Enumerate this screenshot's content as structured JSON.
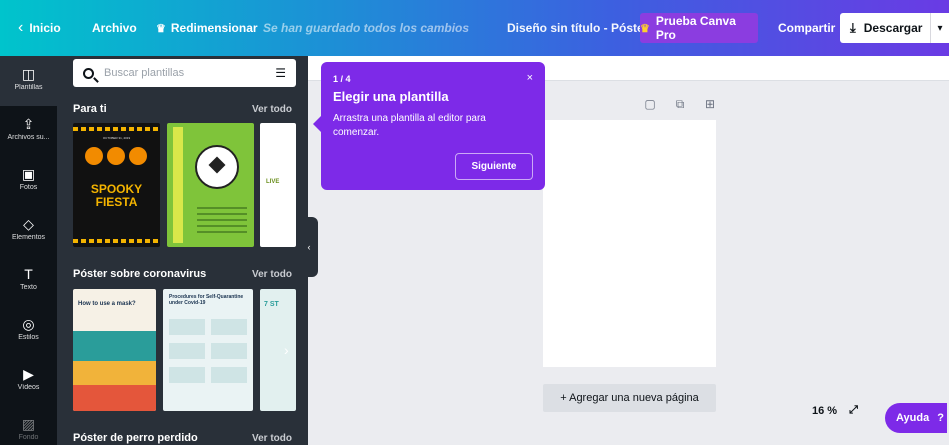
{
  "topbar": {
    "home_label": "Inicio",
    "file_label": "Archivo",
    "resize_label": "Redimensionar",
    "save_status": "Se han guardado todos los cambios",
    "document_title": "Diseño sin título - Póster",
    "pro_label": "Prueba Canva Pro",
    "share_label": "Compartir",
    "download_label": "Descargar"
  },
  "sidebar": {
    "items": [
      {
        "label": "Plantillas",
        "icon": "template-icon"
      },
      {
        "label": "Archivos su...",
        "icon": "upload-icon"
      },
      {
        "label": "Fotos",
        "icon": "photo-icon"
      },
      {
        "label": "Elementos",
        "icon": "shapes-icon"
      },
      {
        "label": "Texto",
        "icon": "text-icon"
      },
      {
        "label": "Estilos",
        "icon": "palette-icon"
      },
      {
        "label": "Vídeos",
        "icon": "video-icon"
      },
      {
        "label": "Fondo",
        "icon": "background-icon"
      }
    ]
  },
  "panel": {
    "search_placeholder": "Buscar plantillas",
    "sections": [
      {
        "title": "Para ti",
        "link": "Ver todo"
      },
      {
        "title": "Póster sobre coronavirus",
        "link": "Ver todo"
      },
      {
        "title": "Póster de perro perdido",
        "link": "Ver todo"
      }
    ],
    "thumbs": {
      "spooky_date": "OCTOBER 31, 2019",
      "spooky_title1": "SPOOKY",
      "spooky_title2": "FIESTA",
      "soccer_text": "SOCCER MATCH",
      "live_text": "LIVE",
      "mask_title": "How to use a mask?",
      "covid_title": "Procedures for Self-Quarantine under Covid-19",
      "steps_text": "7 ST"
    }
  },
  "tooltip": {
    "step": "1 / 4",
    "title": "Elegir una plantilla",
    "body": "Arrastra una plantilla al editor para comenzar.",
    "next_label": "Siguiente",
    "close": "×"
  },
  "canvas": {
    "add_page_label": "+ Agregar una nueva página"
  },
  "footer": {
    "zoom": "16 %",
    "help_label": "Ayuda",
    "help_q": "?"
  },
  "colors": {
    "accent": "#7d2ae8",
    "sidebar_bg": "#0e1318",
    "panel_bg": "#293039"
  }
}
